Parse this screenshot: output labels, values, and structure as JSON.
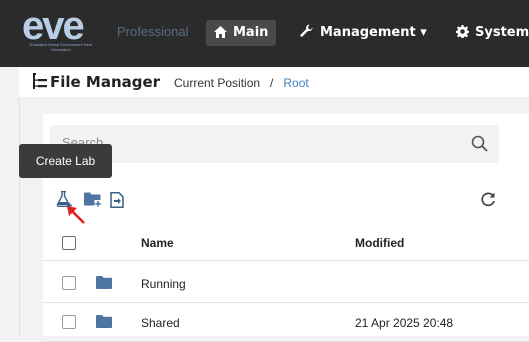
{
  "navbar": {
    "logo_text": "eve",
    "logo_subtext": "Emulated Virtual Environment Next Generation",
    "edition": "Professional",
    "items": [
      {
        "label": "Main",
        "icon": "home-icon"
      },
      {
        "label": "Management ▾",
        "icon": "wrench-icon"
      },
      {
        "label": "System",
        "icon": "gear-icon"
      }
    ]
  },
  "header": {
    "title": "File Manager",
    "breadcrumb_label": "Current Position",
    "breadcrumb_sep": "/",
    "breadcrumb_root": "Root"
  },
  "search": {
    "placeholder": "Search"
  },
  "tooltip": {
    "text": "Create Lab"
  },
  "toolbar": {
    "icons": [
      "create-lab-icon",
      "add-folder-icon",
      "import-file-icon",
      "refresh-icon"
    ]
  },
  "table": {
    "columns": [
      "Name",
      "Modified"
    ],
    "rows": [
      {
        "type": "folder",
        "name": "Running",
        "modified": ""
      },
      {
        "type": "folder",
        "name": "Shared",
        "modified": "21 Apr 2025 20:48"
      }
    ]
  },
  "colors": {
    "navbar_bg": "#2b2b2b",
    "accent_blue": "#3f7fbf",
    "folder_blue": "#4f76a3",
    "arrow_red": "#e02020"
  }
}
